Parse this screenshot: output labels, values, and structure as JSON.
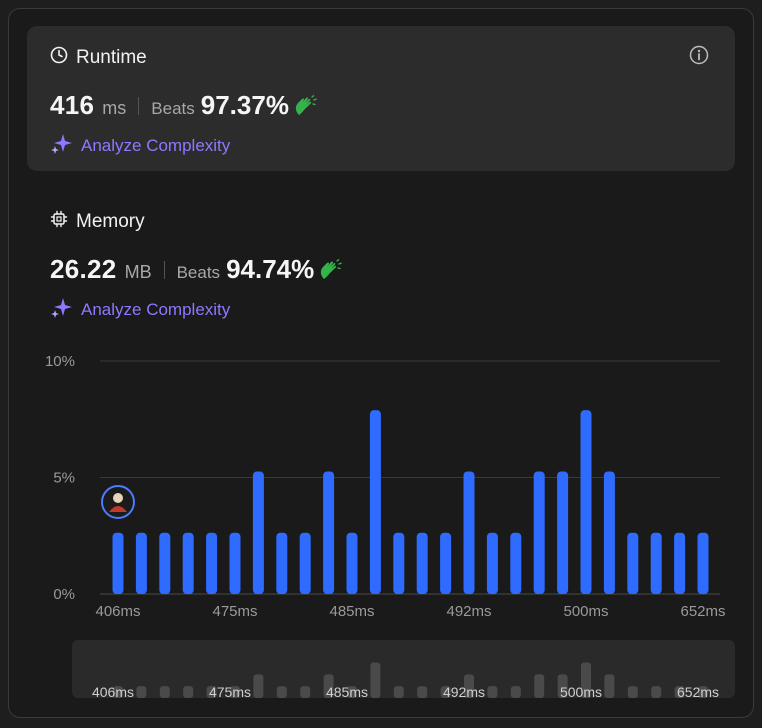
{
  "runtime": {
    "title": "Runtime",
    "value": "416",
    "unit": "ms",
    "beats_label": "Beats",
    "beats_pct": "97.37%",
    "analyze_label": "Analyze Complexity"
  },
  "memory": {
    "title": "Memory",
    "value": "26.22",
    "unit": "MB",
    "beats_label": "Beats",
    "beats_pct": "94.74%",
    "analyze_label": "Analyze Complexity"
  },
  "colors": {
    "accent_purple": "#8c79ff",
    "bar_blue": "#2f6bff",
    "clap_green": "#35b34a"
  },
  "chart_data": {
    "type": "bar",
    "ylim": [
      0,
      10
    ],
    "y_ticks": [
      "10%",
      "5%",
      "0%"
    ],
    "y_tick_values": [
      10,
      5,
      0
    ],
    "x_tick_labels": [
      "406ms",
      "475ms",
      "485ms",
      "492ms",
      "500ms",
      "652ms"
    ],
    "x_tick_indices": [
      0,
      5,
      10,
      15,
      20,
      25
    ],
    "values": [
      2.63,
      2.63,
      2.63,
      2.63,
      2.63,
      2.63,
      5.26,
      2.63,
      2.63,
      5.26,
      2.63,
      7.89,
      2.63,
      2.63,
      2.63,
      5.26,
      2.63,
      2.63,
      5.26,
      5.26,
      7.89,
      5.26,
      2.63,
      2.63,
      2.63,
      2.63
    ],
    "user_marker_index": 0,
    "grid": true
  },
  "navigator": {
    "labels": [
      "406ms",
      "475ms",
      "485ms",
      "492ms",
      "500ms",
      "652ms"
    ]
  }
}
